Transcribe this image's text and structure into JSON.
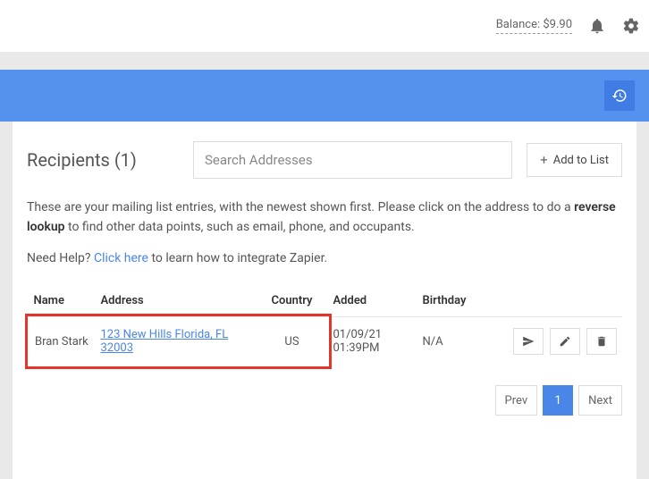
{
  "topbar": {
    "balance_label": "Balance: $9.90"
  },
  "page": {
    "title": "Recipients (1)",
    "search_placeholder": "Search Addresses",
    "add_label": "Add to List",
    "description_pre": "These are your mailing list entries, with the newest shown first. Please click on the address to do a ",
    "description_bold": "reverse lookup",
    "description_post": " to find other data points, such as email, phone, and occupants.",
    "help_pre": "Need Help? ",
    "help_link": "Click here",
    "help_post": " to learn how to integrate Zapier."
  },
  "table": {
    "headers": {
      "name": "Name",
      "address": "Address",
      "country": "Country",
      "added": "Added",
      "birthday": "Birthday"
    },
    "rows": [
      {
        "name": "Bran Stark",
        "address": "123 New Hills Florida, FL 32003",
        "country": "US",
        "added": "01/09/21 01:39PM",
        "birthday": "N/A"
      }
    ]
  },
  "pager": {
    "prev": "Prev",
    "current": "1",
    "next": "Next"
  }
}
